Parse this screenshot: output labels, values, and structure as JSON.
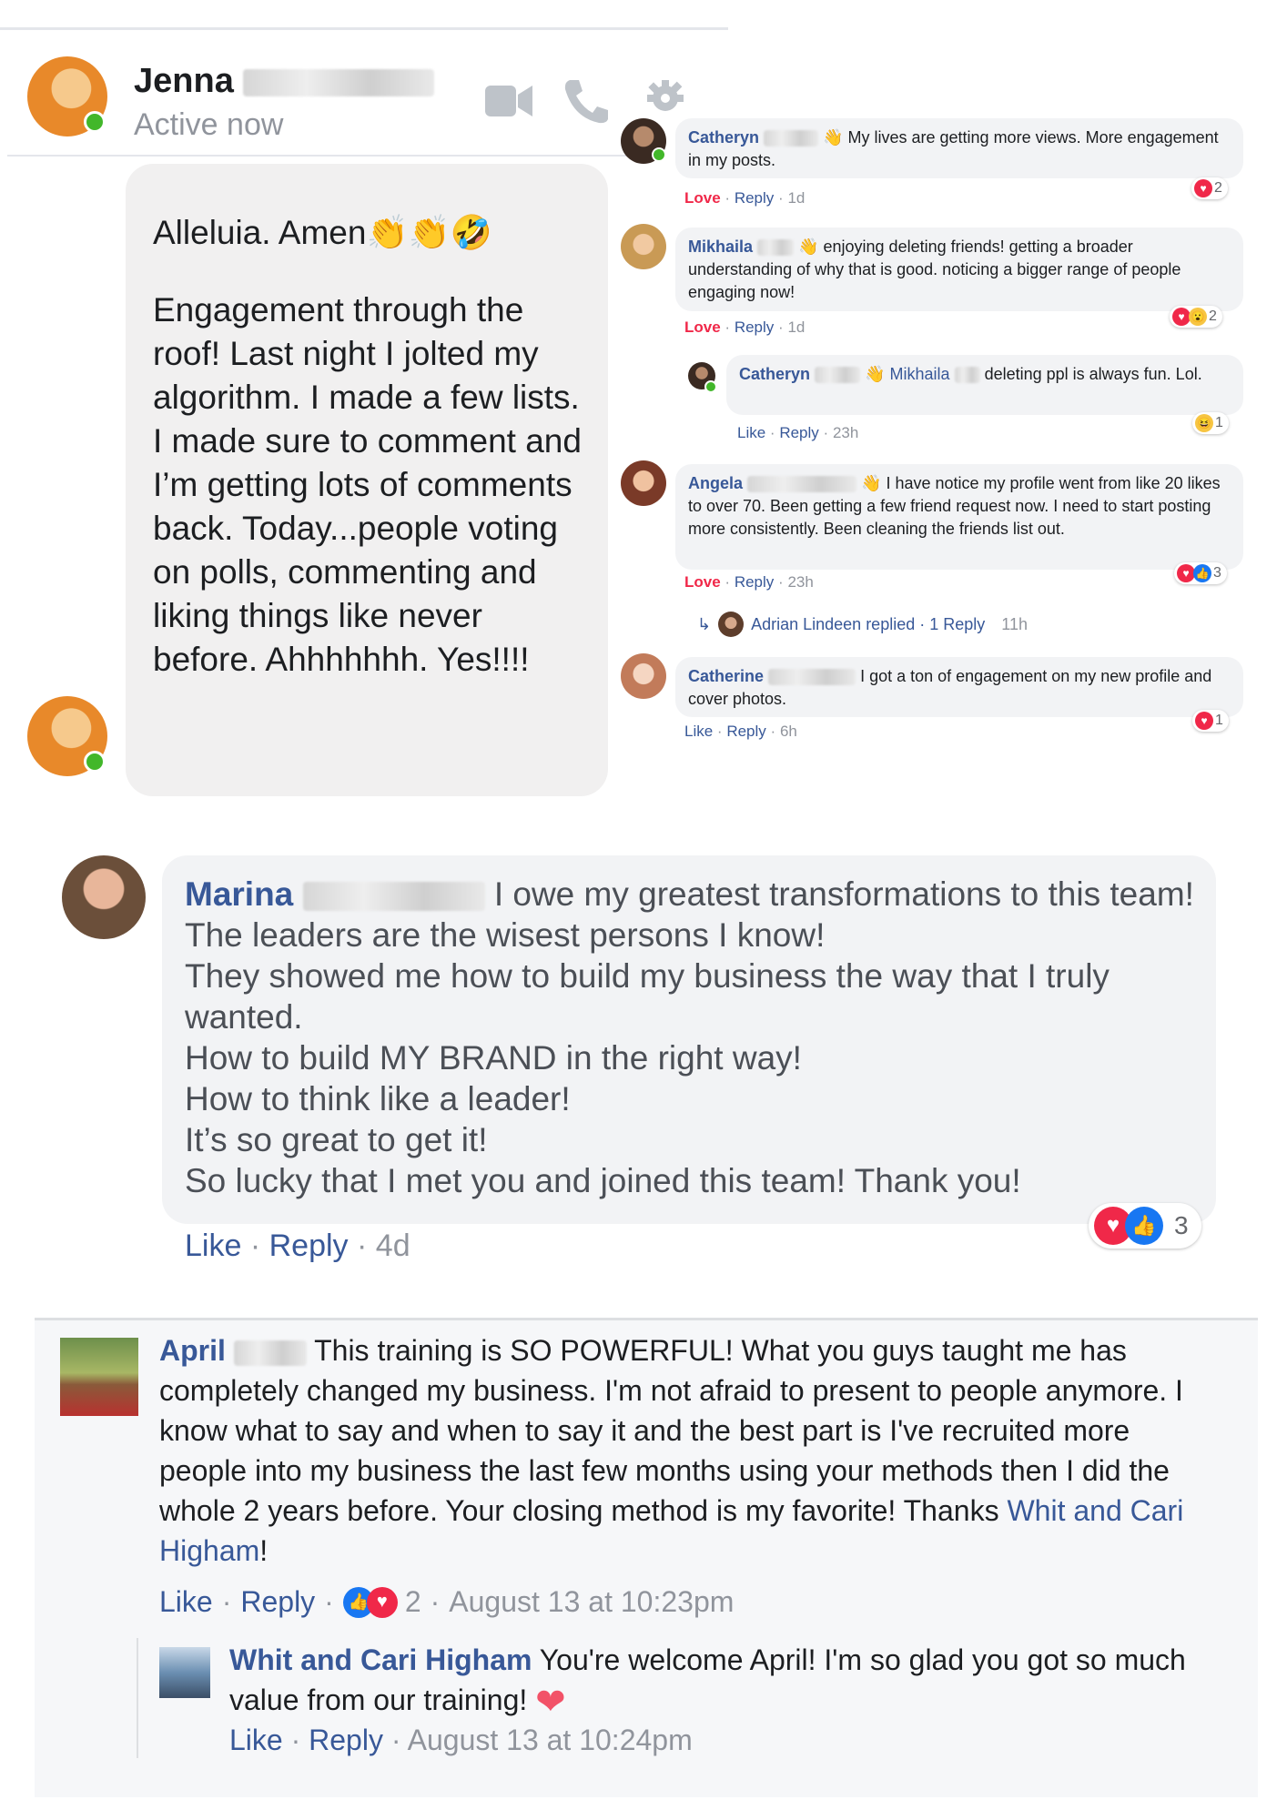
{
  "messenger": {
    "contact_name": "Jenna",
    "status": "Active now",
    "icons": [
      "video-camera-icon",
      "phone-icon",
      "gear-icon"
    ],
    "message_line1": "Alleluia. Amen",
    "message_emojis": "👏👏🤣",
    "message_body": "Engagement through the roof!   Last night I jolted my algorithm. I made a few lists.  I made sure to comment and I’m getting lots of comments back. Today...people voting on polls, commenting and liking things like never before.  Ahhhhhhh. Yes!!!!"
  },
  "comments": [
    {
      "name": "Catheryn",
      "text": "My lives are getting more views. More engagement in my posts.",
      "reaction_label": "Love",
      "reply_label": "Reply",
      "time": "1d",
      "reaction_count": "2"
    },
    {
      "name": "Mikhaila",
      "text": "enjoying deleting friends! getting a broader understanding of why that is good. noticing a bigger range of people engaging now!",
      "reaction_label": "Love",
      "reply_label": "Reply",
      "time": "1d",
      "reaction_count": "2"
    },
    {
      "name": "Catheryn",
      "mention": "Mikhaila",
      "text": "deleting ppl is always fun. Lol.",
      "reaction_label": "Like",
      "reply_label": "Reply",
      "time": "23h",
      "reaction_count": "1"
    },
    {
      "name": "Angela",
      "text": "I have notice my profile went from like 20 likes to over 70. Been getting a few friend request now. I need to start posting more consistently. Been cleaning the friends list out.",
      "reaction_label": "Love",
      "reply_label": "Reply",
      "time": "23h",
      "reaction_count": "3"
    },
    {
      "name": "Catherine",
      "text": "I got a ton of engagement on my new profile and cover photos.",
      "reaction_label": "Like",
      "reply_label": "Reply",
      "time": "6h",
      "reaction_count": "1"
    }
  ],
  "replied_row": {
    "text": "Adrian Lindeen replied · 1 Reply",
    "time": "11h"
  },
  "marina": {
    "name": "Marina",
    "lines": [
      "I owe my greatest transformations to this team!",
      "The leaders are the wisest persons I know!",
      "They showed me how to build my business the way that I truly",
      "wanted.",
      "How to build MY BRAND in the right way!",
      "How to think like a leader!",
      "It’s so great to get it!",
      "So lucky that I met you and joined this team! Thank you!"
    ],
    "like_label": "Like",
    "reply_label": "Reply",
    "time": "4d",
    "reaction_count": "3"
  },
  "april": {
    "name": "April",
    "text": "This training is SO POWERFUL! What you guys taught me has completely changed my business. I'm not afraid to present to people anymore. I know what to say and when to say it and the best part is I've recruited more people into my business the last few months using your methods then I did the whole 2 years before. Your closing method is my favorite! Thanks",
    "mention": "Whit and Cari Higham",
    "end_punct": "!",
    "like_label": "Like",
    "reply_label": "Reply",
    "reaction_count": "2",
    "timestamp": "August 13 at 10:23pm"
  },
  "whit_reply": {
    "name": "Whit and Cari Higham",
    "text": "You're welcome April! I'm so glad you got so much value from our training!",
    "like_label": "Like",
    "reply_label": "Reply",
    "timestamp": "August 13 at 10:24pm"
  },
  "colors": {
    "link": "#385898",
    "love": "#f02849",
    "online": "#42b72a",
    "bubble": "#f2f3f5",
    "messenger_bubble": "#f1f0f0"
  }
}
